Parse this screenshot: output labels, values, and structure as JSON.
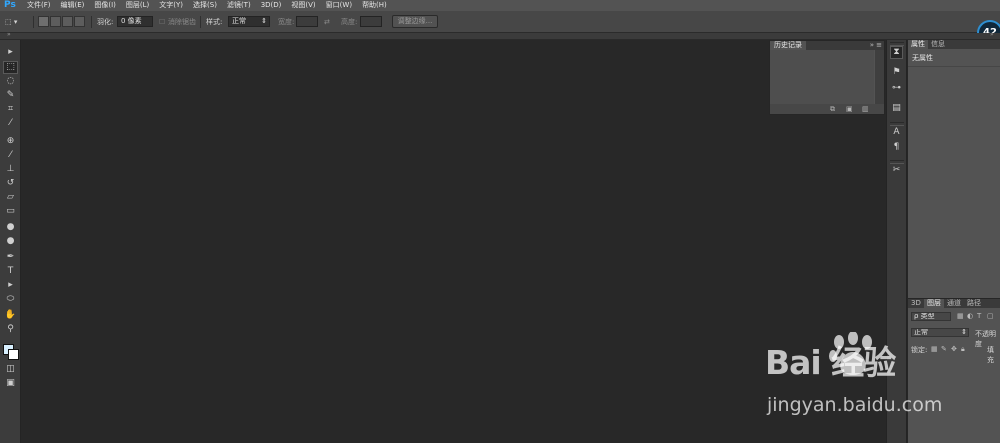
{
  "app": {
    "logo": "Ps"
  },
  "menu": [
    "文件(F)",
    "编辑(E)",
    "图像(I)",
    "图层(L)",
    "文字(Y)",
    "选择(S)",
    "滤镜(T)",
    "3D(D)",
    "视图(V)",
    "窗口(W)",
    "帮助(H)"
  ],
  "options": {
    "tool_icon": "marquee-icon",
    "feather_label": "羽化:",
    "feather_value": "0 像素",
    "antialias_label": "消除锯齿",
    "style_label": "样式:",
    "style_value": "正常",
    "width_label": "宽度:",
    "height_label": "高度:",
    "refine_edge_button": "调整边缘..."
  },
  "zoom_badge": "42",
  "tools": [
    "move-tool-icon",
    "rect-marquee-icon",
    "lasso-icon",
    "quick-select-icon",
    "crop-icon",
    "eyedropper-icon",
    "spot-heal-icon",
    "brush-icon",
    "clone-stamp-icon",
    "history-brush-icon",
    "eraser-icon",
    "gradient-icon",
    "blur-icon",
    "dodge-icon",
    "pen-icon",
    "type-icon",
    "path-select-icon",
    "ellipse-icon",
    "hand-icon",
    "zoom-icon",
    "color-swatch-icon",
    "quick-mask-icon",
    "screen-mode-icon"
  ],
  "history_panel": {
    "tab": "历史记录"
  },
  "properties_panel": {
    "tabs": [
      "属性",
      "信息"
    ],
    "label": "无属性"
  },
  "layers_panel": {
    "tabs": [
      "3D",
      "图层",
      "通道",
      "路径"
    ],
    "filter_value": "ρ 类型",
    "blend_mode": "正常",
    "opacity_label": "不透明度",
    "lock_label": "锁定:",
    "fill_label": "填充"
  },
  "watermark": {
    "brand": "Bai 经验",
    "url": "jingyan.baidu.com"
  }
}
